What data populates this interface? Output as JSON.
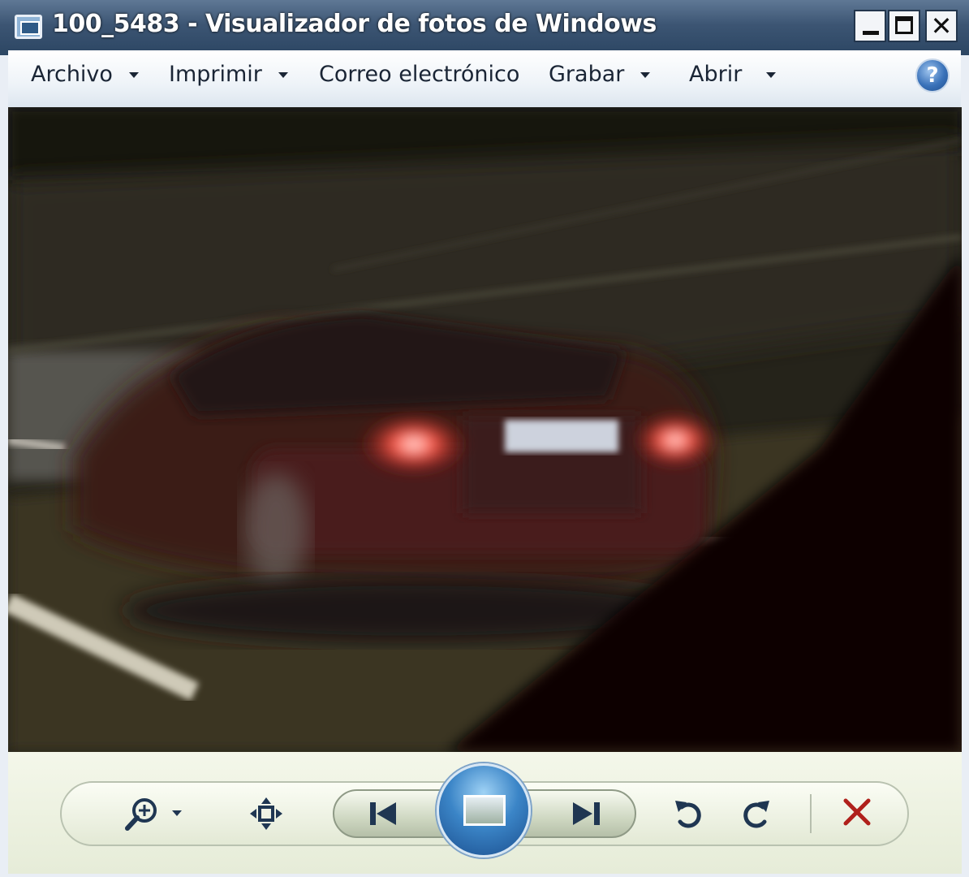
{
  "window": {
    "title": "100_5483 - Visualizador de fotos de Windows"
  },
  "menubar": {
    "items": [
      {
        "label": "Archivo",
        "has_dropdown": true
      },
      {
        "label": "Imprimir",
        "has_dropdown": true
      },
      {
        "label": "Correo electrónico",
        "has_dropdown": false
      },
      {
        "label": "Grabar",
        "has_dropdown": true
      },
      {
        "label": "Abrir",
        "has_dropdown": true
      }
    ],
    "help_glyph": "?"
  },
  "controls": {
    "icons": [
      "zoom-icon",
      "fit-to-window-icon",
      "previous-icon",
      "slideshow-icon",
      "next-icon",
      "rotate-counterclockwise-icon",
      "rotate-clockwise-icon",
      "delete-icon"
    ]
  },
  "colors": {
    "titlebar": "#3c5573",
    "accent_blue": "#3b85c7",
    "delete_red": "#b0201b"
  }
}
